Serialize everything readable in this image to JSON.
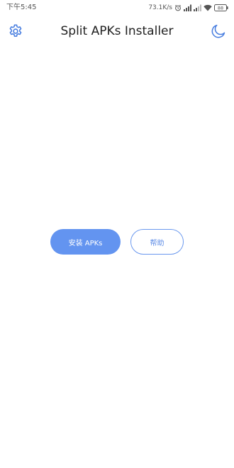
{
  "status_bar": {
    "time": "下午5:45",
    "network_speed": "73.1K/s",
    "battery_level": "88",
    "icons": [
      "alarm-icon",
      "signal-icon",
      "signal-icon",
      "wifi-icon",
      "battery-icon"
    ]
  },
  "toolbar": {
    "title": "Split APKs Installer",
    "left_icon": "gear-icon",
    "right_icon": "moon-icon"
  },
  "main": {
    "install_label": "安装 APKs",
    "help_label": "帮助"
  },
  "colors": {
    "accent": "#6394f0",
    "icon": "#4a7fe0",
    "background": "#ffffff"
  }
}
